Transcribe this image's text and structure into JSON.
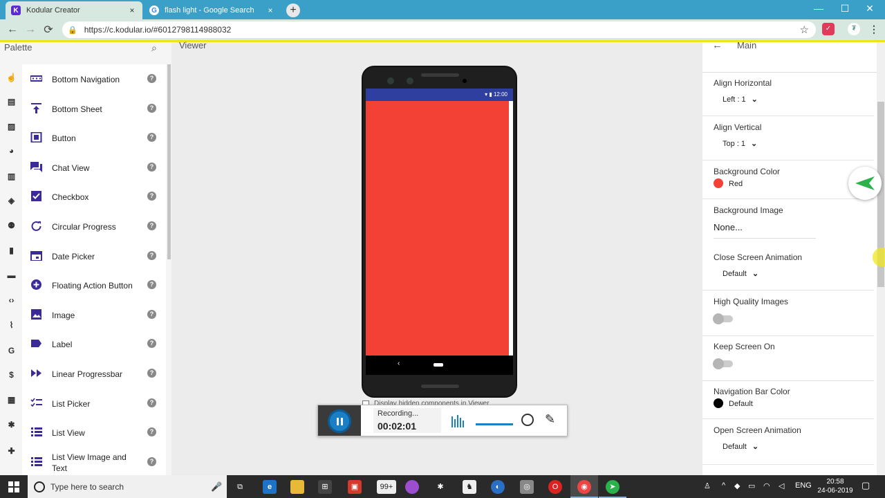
{
  "browser": {
    "tabs": [
      {
        "title": "Kodular Creator",
        "favicon": "K"
      },
      {
        "title": "flash light - Google Search",
        "favicon": "G"
      }
    ],
    "close_glyph": "×",
    "new_tab_glyph": "+",
    "url": "https://c.kodular.io/#6012798114988032",
    "window_controls": [
      "—",
      "☐",
      "✕"
    ]
  },
  "palette": {
    "title": "Palette",
    "rail_icons": [
      "touch-icon",
      "layout-icon",
      "media-icon",
      "palette-icon",
      "map-icon",
      "compass-icon",
      "people-icon",
      "file-icon",
      "briefcase-icon",
      "code-icon",
      "rss-icon",
      "google-icon",
      "dollar-icon",
      "widgets-icon",
      "bug-icon",
      "puzzle-icon"
    ],
    "items": [
      {
        "label": "Bottom Navigation",
        "icon": "bottom-navigation-icon"
      },
      {
        "label": "Bottom Sheet",
        "icon": "bottom-sheet-icon"
      },
      {
        "label": "Button",
        "icon": "button-icon"
      },
      {
        "label": "Chat View",
        "icon": "chat-view-icon"
      },
      {
        "label": "Checkbox",
        "icon": "checkbox-icon"
      },
      {
        "label": "Circular Progress",
        "icon": "circular-progress-icon"
      },
      {
        "label": "Date Picker",
        "icon": "date-picker-icon"
      },
      {
        "label": "Floating Action Button",
        "icon": "floating-action-button-icon"
      },
      {
        "label": "Image",
        "icon": "image-icon"
      },
      {
        "label": "Label",
        "icon": "label-icon"
      },
      {
        "label": "Linear Progressbar",
        "icon": "linear-progressbar-icon"
      },
      {
        "label": "List Picker",
        "icon": "list-picker-icon"
      },
      {
        "label": "List View",
        "icon": "list-view-icon"
      },
      {
        "label": "List View Image and Text",
        "icon": "list-view-image-icon"
      }
    ],
    "help_glyph": "?"
  },
  "viewer": {
    "title": "Viewer",
    "phone_status_time": "12:00",
    "screen_color": "#f34235",
    "hidden_components_label": "Display hidden components in Viewer"
  },
  "recording": {
    "status": "Recording...",
    "elapsed": "00:02:01"
  },
  "properties": {
    "component": "Main",
    "items": [
      {
        "name": "Align Horizontal",
        "value": "Left : 1"
      },
      {
        "name": "Align Vertical",
        "value": "Top : 1"
      },
      {
        "name": "Background Color",
        "value": "Red",
        "color": "#f34235"
      },
      {
        "name": "Background Image",
        "value": "None..."
      },
      {
        "name": "Close Screen Animation",
        "value": "Default"
      },
      {
        "name": "High Quality Images",
        "toggle": false
      },
      {
        "name": "Keep Screen On",
        "toggle": false
      },
      {
        "name": "Navigation Bar Color",
        "value": "Default",
        "color": "#000000"
      },
      {
        "name": "Open Screen Animation",
        "value": "Default"
      }
    ]
  },
  "taskbar": {
    "search_placeholder": "Type here to search",
    "store_badge": "99+",
    "language": "ENG",
    "time": "20:58",
    "date": "24-06-2019"
  }
}
